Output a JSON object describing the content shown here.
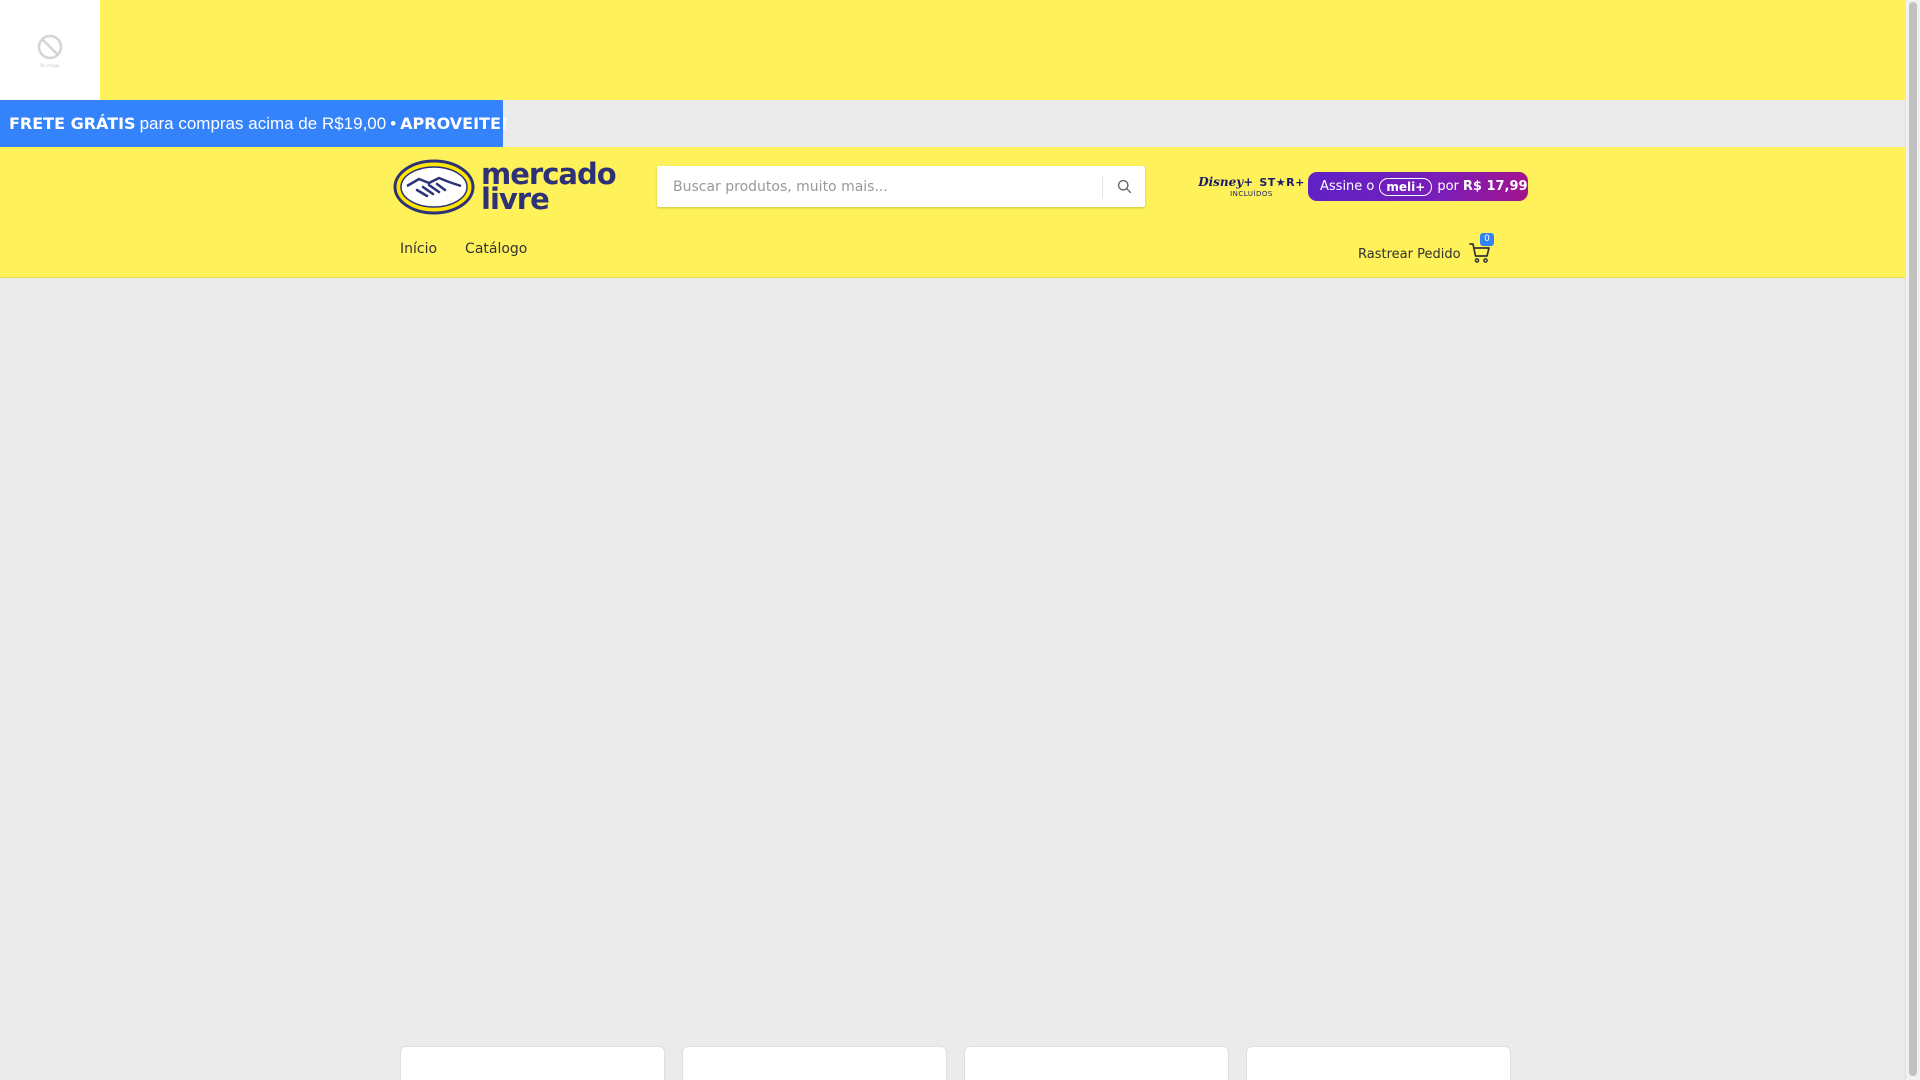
{
  "top_image": {
    "caption": "No image",
    "icon": "no-image-icon"
  },
  "promo": {
    "highlight": "FRETE GRÁTIS",
    "middle": "para compras acima de R$19,00",
    "separator": "•",
    "cta": "APROVEITE!",
    "background": "#3483fa"
  },
  "header": {
    "background": "#fff159",
    "logo": {
      "line1": "mercado",
      "line2": "livre",
      "brand_color": "#2d3277"
    },
    "search": {
      "placeholder": "Buscar produtos, muito mais...",
      "value": "",
      "icon": "search-icon"
    },
    "banner": {
      "disney": "Disney+",
      "star": "ST★R+",
      "included": "INCLUÍDOS",
      "subscribe": "Assine o",
      "meli": "meli+",
      "por": "por",
      "price": "R$ 17,99"
    },
    "nav": [
      {
        "label": "Início"
      },
      {
        "label": "Catálogo"
      }
    ],
    "track_order": "Rastrear Pedido",
    "cart": {
      "count": "0",
      "icon": "cart-icon"
    }
  },
  "colors": {
    "page_background": "#ebebeb",
    "accent": "#3483fa",
    "yellow": "#fff159"
  }
}
